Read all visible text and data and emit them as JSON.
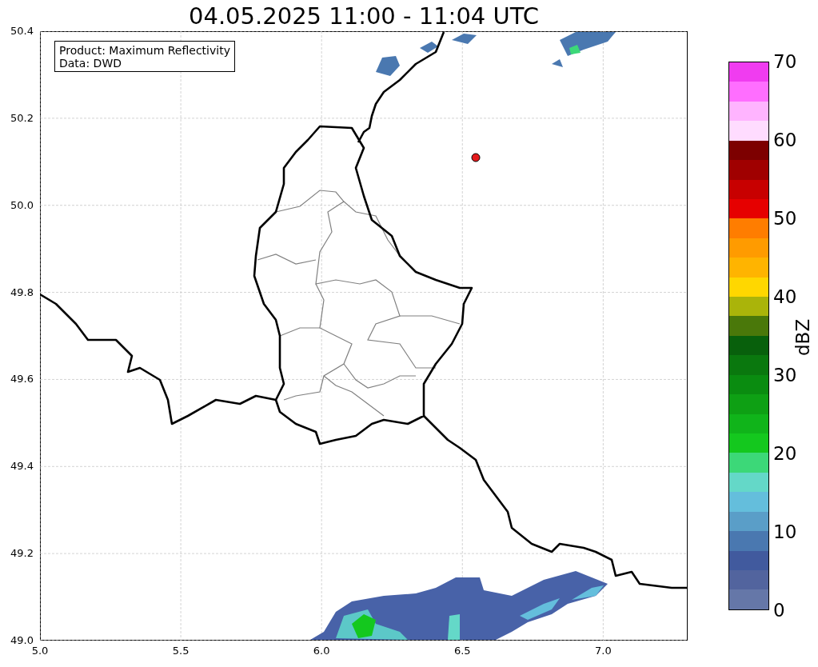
{
  "title": "04.05.2025 11:00 - 11:04 UTC",
  "info_box": {
    "lines": [
      "Product: Maximum Reflectivity",
      "Data: DWD"
    ]
  },
  "map": {
    "xticks": [
      "5.0",
      "5.5",
      "6.0",
      "6.5",
      "7.0"
    ],
    "yticks": [
      "50.4",
      "50.2",
      "50.0",
      "49.8",
      "49.6",
      "49.4",
      "49.2",
      "49.0"
    ],
    "marker": {
      "color": "#e41a1c"
    }
  },
  "colorbar": {
    "label": "dBZ",
    "ticks": [
      "70",
      "60",
      "50",
      "40",
      "30",
      "20",
      "10",
      "0"
    ],
    "segments": [
      {
        "color": "#f03cf0"
      },
      {
        "color": "#ff6eff"
      },
      {
        "color": "#ffb4ff"
      },
      {
        "color": "#ffdcff"
      },
      {
        "color": "#7d0000"
      },
      {
        "color": "#a00000"
      },
      {
        "color": "#c80000"
      },
      {
        "color": "#e60000"
      },
      {
        "color": "#ff7d00"
      },
      {
        "color": "#ff9b00"
      },
      {
        "color": "#ffb400"
      },
      {
        "color": "#ffd700"
      },
      {
        "color": "#aab40a"
      },
      {
        "color": "#4a780a"
      },
      {
        "color": "#08600c"
      },
      {
        "color": "#0a780e"
      },
      {
        "color": "#0a8c10"
      },
      {
        "color": "#0ea014"
      },
      {
        "color": "#10b41a"
      },
      {
        "color": "#14c81e"
      },
      {
        "color": "#3cd878"
      },
      {
        "color": "#64d8c8"
      },
      {
        "color": "#64bedc"
      },
      {
        "color": "#5a9ec8"
      },
      {
        "color": "#4a78b0"
      },
      {
        "color": "#415a9e"
      },
      {
        "color": "#52649e"
      },
      {
        "color": "#6577a8"
      }
    ]
  }
}
